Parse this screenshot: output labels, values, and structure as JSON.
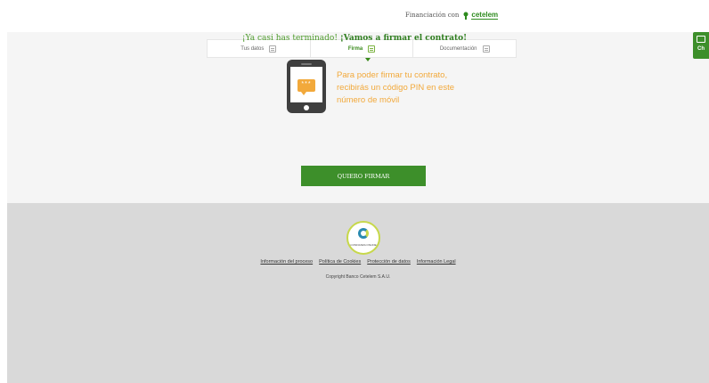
{
  "header": {
    "financing_text": "Financiación con",
    "brand_name": "cetelem",
    "brand_color": "#2e8b1e"
  },
  "steps": [
    {
      "label": "Tus datos",
      "active": false,
      "icon": "document-icon"
    },
    {
      "label": "Firma",
      "active": true,
      "icon": "sign-icon"
    },
    {
      "label": "Documentación",
      "active": false,
      "icon": "upload-icon"
    }
  ],
  "headline": {
    "part1": "¡Ya casi has terminado! ",
    "part2": "¡Vamos a firmar el contrato!"
  },
  "phone": {
    "bubble_text": "***"
  },
  "pin_message": "Para poder firmar tu contrato, recibirás un código PIN en este número de móvil",
  "cta_label": "QUIERO FIRMAR",
  "footer": {
    "seal_text": "CONFIANZA ONLINE",
    "links": [
      "Información del proceso",
      "Política de Cookies",
      "Protección de datos",
      "Información Legal"
    ],
    "copyright": "Copyright Banco Cetelem S.A.U."
  },
  "chat": {
    "label": "Ch"
  },
  "colors": {
    "accent_green": "#3d8f2a",
    "orange": "#f2a93b",
    "footer_bg": "#d9d9d9"
  }
}
